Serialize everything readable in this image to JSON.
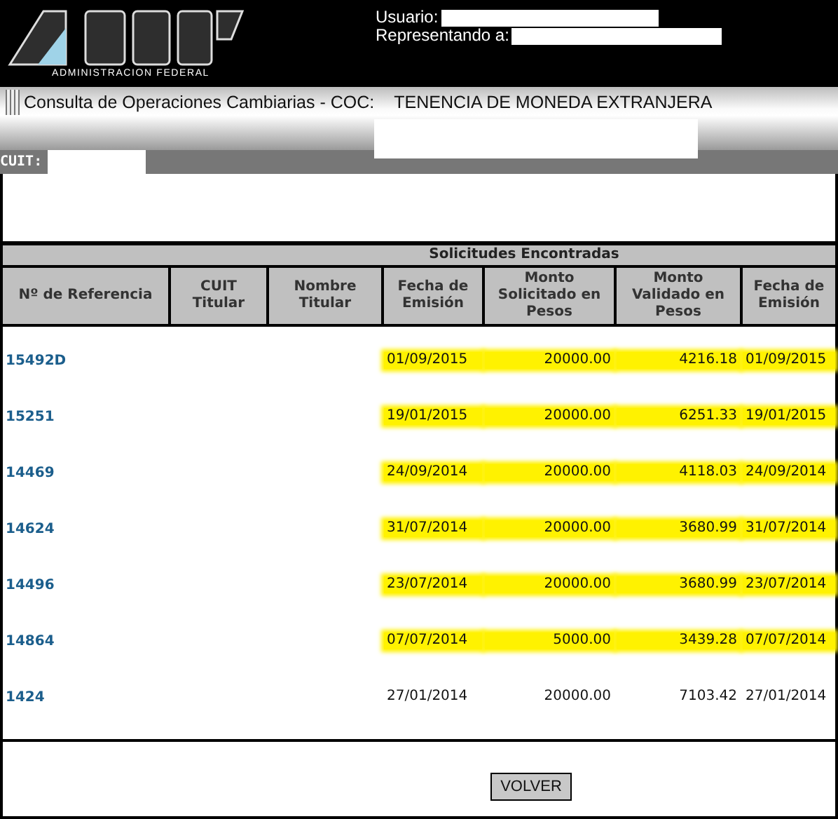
{
  "header": {
    "logo_subtitle": "ADMINISTRACION FEDERAL",
    "user_label": "Usuario:",
    "represents_label": "Representando a:"
  },
  "title_bar": {
    "title": "Consulta de Operaciones Cambiarias - COC:",
    "subtitle": "TENENCIA DE MONEDA EXTRANJERA",
    "cuit_label": "CUIT:"
  },
  "table": {
    "caption": "Solicitudes Encontradas",
    "columns": [
      "Nº de Referencia",
      "CUIT Titular",
      "Nombre Titular",
      "Fecha de Emisión",
      "Monto Solicitado en Pesos",
      "Monto Validado en Pesos",
      "Fecha de Emisión"
    ],
    "rows": [
      {
        "reference": "15492D",
        "date": "01/09/2015",
        "requested": "20000.00",
        "validated": "4216.18",
        "date_2": "01/09/2015",
        "highlighted": true
      },
      {
        "reference": "15251",
        "date": "19/01/2015",
        "requested": "20000.00",
        "validated": "6251.33",
        "date_2": "19/01/2015",
        "highlighted": true
      },
      {
        "reference": "14469",
        "date": "24/09/2014",
        "requested": "20000.00",
        "validated": "4118.03",
        "date_2": "24/09/2014",
        "highlighted": true
      },
      {
        "reference": "14624",
        "date": "31/07/2014",
        "requested": "20000.00",
        "validated": "3680.99",
        "date_2": "31/07/2014",
        "highlighted": true
      },
      {
        "reference": "14496",
        "date": "23/07/2014",
        "requested": "20000.00",
        "validated": "3680.99",
        "date_2": "23/07/2014",
        "highlighted": true
      },
      {
        "reference": "14864",
        "date": "07/07/2014",
        "requested": "5000.00",
        "validated": "3439.28",
        "date_2": "07/07/2014",
        "highlighted": true
      },
      {
        "reference": "1424",
        "date": "27/01/2014",
        "requested": "20000.00",
        "validated": "7103.42",
        "date_2": "27/01/2014",
        "highlighted": false
      }
    ]
  },
  "buttons": [
    "VOLVER"
  ]
}
